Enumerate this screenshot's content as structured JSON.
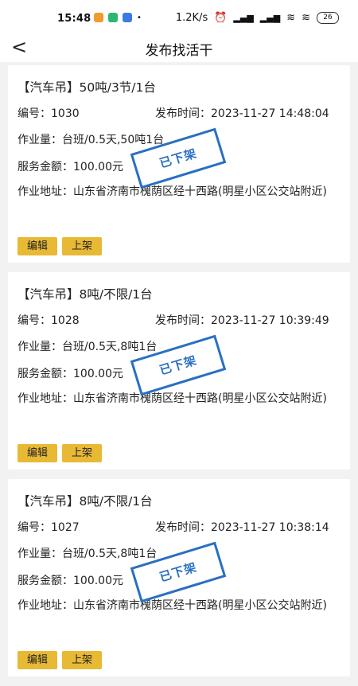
{
  "status_bar": {
    "time": "15:48",
    "net_speed": "1.2K/s",
    "battery": "26"
  },
  "nav": {
    "back_label": "<",
    "title": "发布找活干"
  },
  "cards": [
    {
      "heading": "【汽车吊】50吨/3节/1台",
      "id_label": "编号：",
      "id_value": "1030",
      "time_label": "发布时间：",
      "time_value": "2023-11-27 14:48:04",
      "workload_label": "作业量：",
      "workload_value": "台班/0.5天,50吨1台",
      "amount_label": "服务金额：",
      "amount_value": "100.00元",
      "address_label": "作业地址：",
      "address_value": "山东省济南市槐荫区经十西路(明星小区公交站附近)",
      "stamp": "已下架",
      "edit_label": "编辑",
      "shelve_label": "上架"
    },
    {
      "heading": "【汽车吊】8吨/不限/1台",
      "id_label": "编号：",
      "id_value": "1028",
      "time_label": "发布时间：",
      "time_value": "2023-11-27 10:39:49",
      "workload_label": "作业量：",
      "workload_value": "台班/0.5天,8吨1台",
      "amount_label": "服务金额：",
      "amount_value": "100.00元",
      "address_label": "作业地址：",
      "address_value": "山东省济南市槐荫区经十西路(明星小区公交站附近)",
      "stamp": "已下架",
      "edit_label": "编辑",
      "shelve_label": "上架"
    },
    {
      "heading": "【汽车吊】8吨/不限/1台",
      "id_label": "编号：",
      "id_value": "1027",
      "time_label": "发布时间：",
      "time_value": "2023-11-27 10:38:14",
      "workload_label": "作业量：",
      "workload_value": "台班/0.5天,8吨1台",
      "amount_label": "服务金额：",
      "amount_value": "100.00元",
      "address_label": "作业地址：",
      "address_value": "山东省济南市槐荫区经十西路(明星小区公交站附近)",
      "stamp": "已下架",
      "edit_label": "编辑",
      "shelve_label": "上架"
    }
  ],
  "colors": {
    "accent_button": "#e8b935",
    "stamp": "#2a6fc2",
    "background": "#f2f2f2"
  }
}
